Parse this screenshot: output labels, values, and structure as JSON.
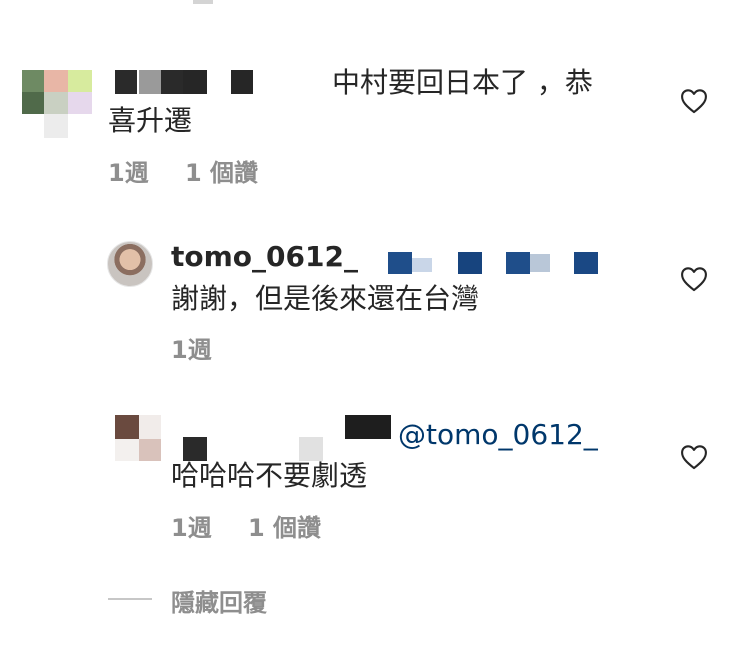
{
  "comments": [
    {
      "text_line1": "中村要回日本了 ，恭",
      "text_line2": "喜升遷",
      "time": "1週",
      "likes": "1 個讚"
    },
    {
      "username": "tomo_0612_",
      "text": "謝謝，但是後來還在台灣",
      "time": "1週"
    },
    {
      "mention": "@tomo_0612_",
      "text": "哈哈哈不要劇透",
      "time": "1週",
      "likes": "1 個讚"
    }
  ],
  "hide_replies_label": "隱藏回覆",
  "icons": {
    "like": "heart-outline-icon"
  },
  "colors": {
    "text": "#262626",
    "secondary": "#8e8e8e",
    "mention": "#00376b",
    "divider": "#c7c7c7"
  }
}
